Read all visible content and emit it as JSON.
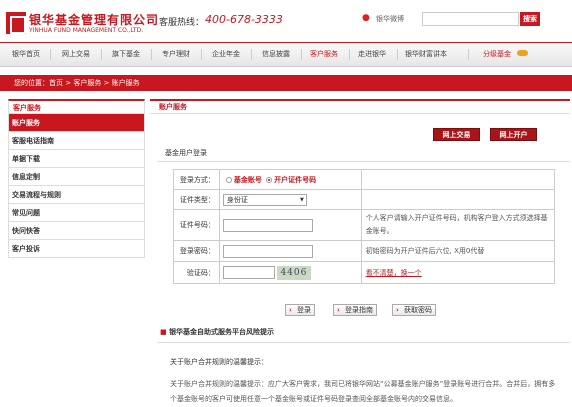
{
  "header": {
    "logo_cn": "银华基金管理有限公司",
    "logo_en": "YINHUA FUND MANAGEMENT CO.,LTD.",
    "hotline_label": "客服热线：",
    "hotline": "400-678-3333",
    "weibo": "银华微博",
    "search_button": "搜索"
  },
  "nav": {
    "items": [
      "银华首页",
      "网上交易",
      "旗下基金",
      "专户理财",
      "企业年金",
      "信息披露",
      "客户服务",
      "走进银华",
      "银华财富讲本",
      "分级基金"
    ],
    "active": "客户服务"
  },
  "breadcrumb": "您的位置：首页 > 客户服务 > 账户服务",
  "sidebar": {
    "title": "客户服务",
    "items": [
      "账户服务",
      "客服电话指南",
      "单据下载",
      "信息定制",
      "交易流程与规则",
      "常见问题",
      "快问快答",
      "客户投诉"
    ],
    "active": "账户服务"
  },
  "main": {
    "title": "账户服务",
    "online_trade_button": "网上交易",
    "open_account_button": "网上开户",
    "login_heading": "基金用户登录"
  },
  "form": {
    "login_mode_label": "登录方式：",
    "option_fund_account": "基金账号",
    "option_id_number": "开户证件号码",
    "id_type_label": "证件类型：",
    "id_type_value": "身份证",
    "id_number_label": "证件号码：",
    "id_hint": "个人客户请输入开户证件号码，机构客户登入方式须选择基金账号。",
    "password_label": "登录密码：",
    "password_hint": "初始密码为开户证件后六位, X用0代替",
    "captcha_label": "验证码：",
    "captcha_text": "4406",
    "captcha_refresh": "看不清楚，换一个"
  },
  "buttons": {
    "login": "登录",
    "login_guide": "登录指南",
    "get_password": "获取密码"
  },
  "risk_title": "银华基金自助式服务平台风险提示",
  "notice": {
    "title": "关于账户合并规则的温馨提示：",
    "text": "关于账户合并规则的温馨提示：应广大客户需求，我司已将银华网站“公募基金账户服务”登录账号进行合并。合并后，拥有多个基金账号的客户可使用任意一个基金账号或证件号码登录查阅全部基金账号内的交易信息。"
  },
  "colors": {
    "brand": "#c8171e",
    "dark_button": "#a81418"
  }
}
